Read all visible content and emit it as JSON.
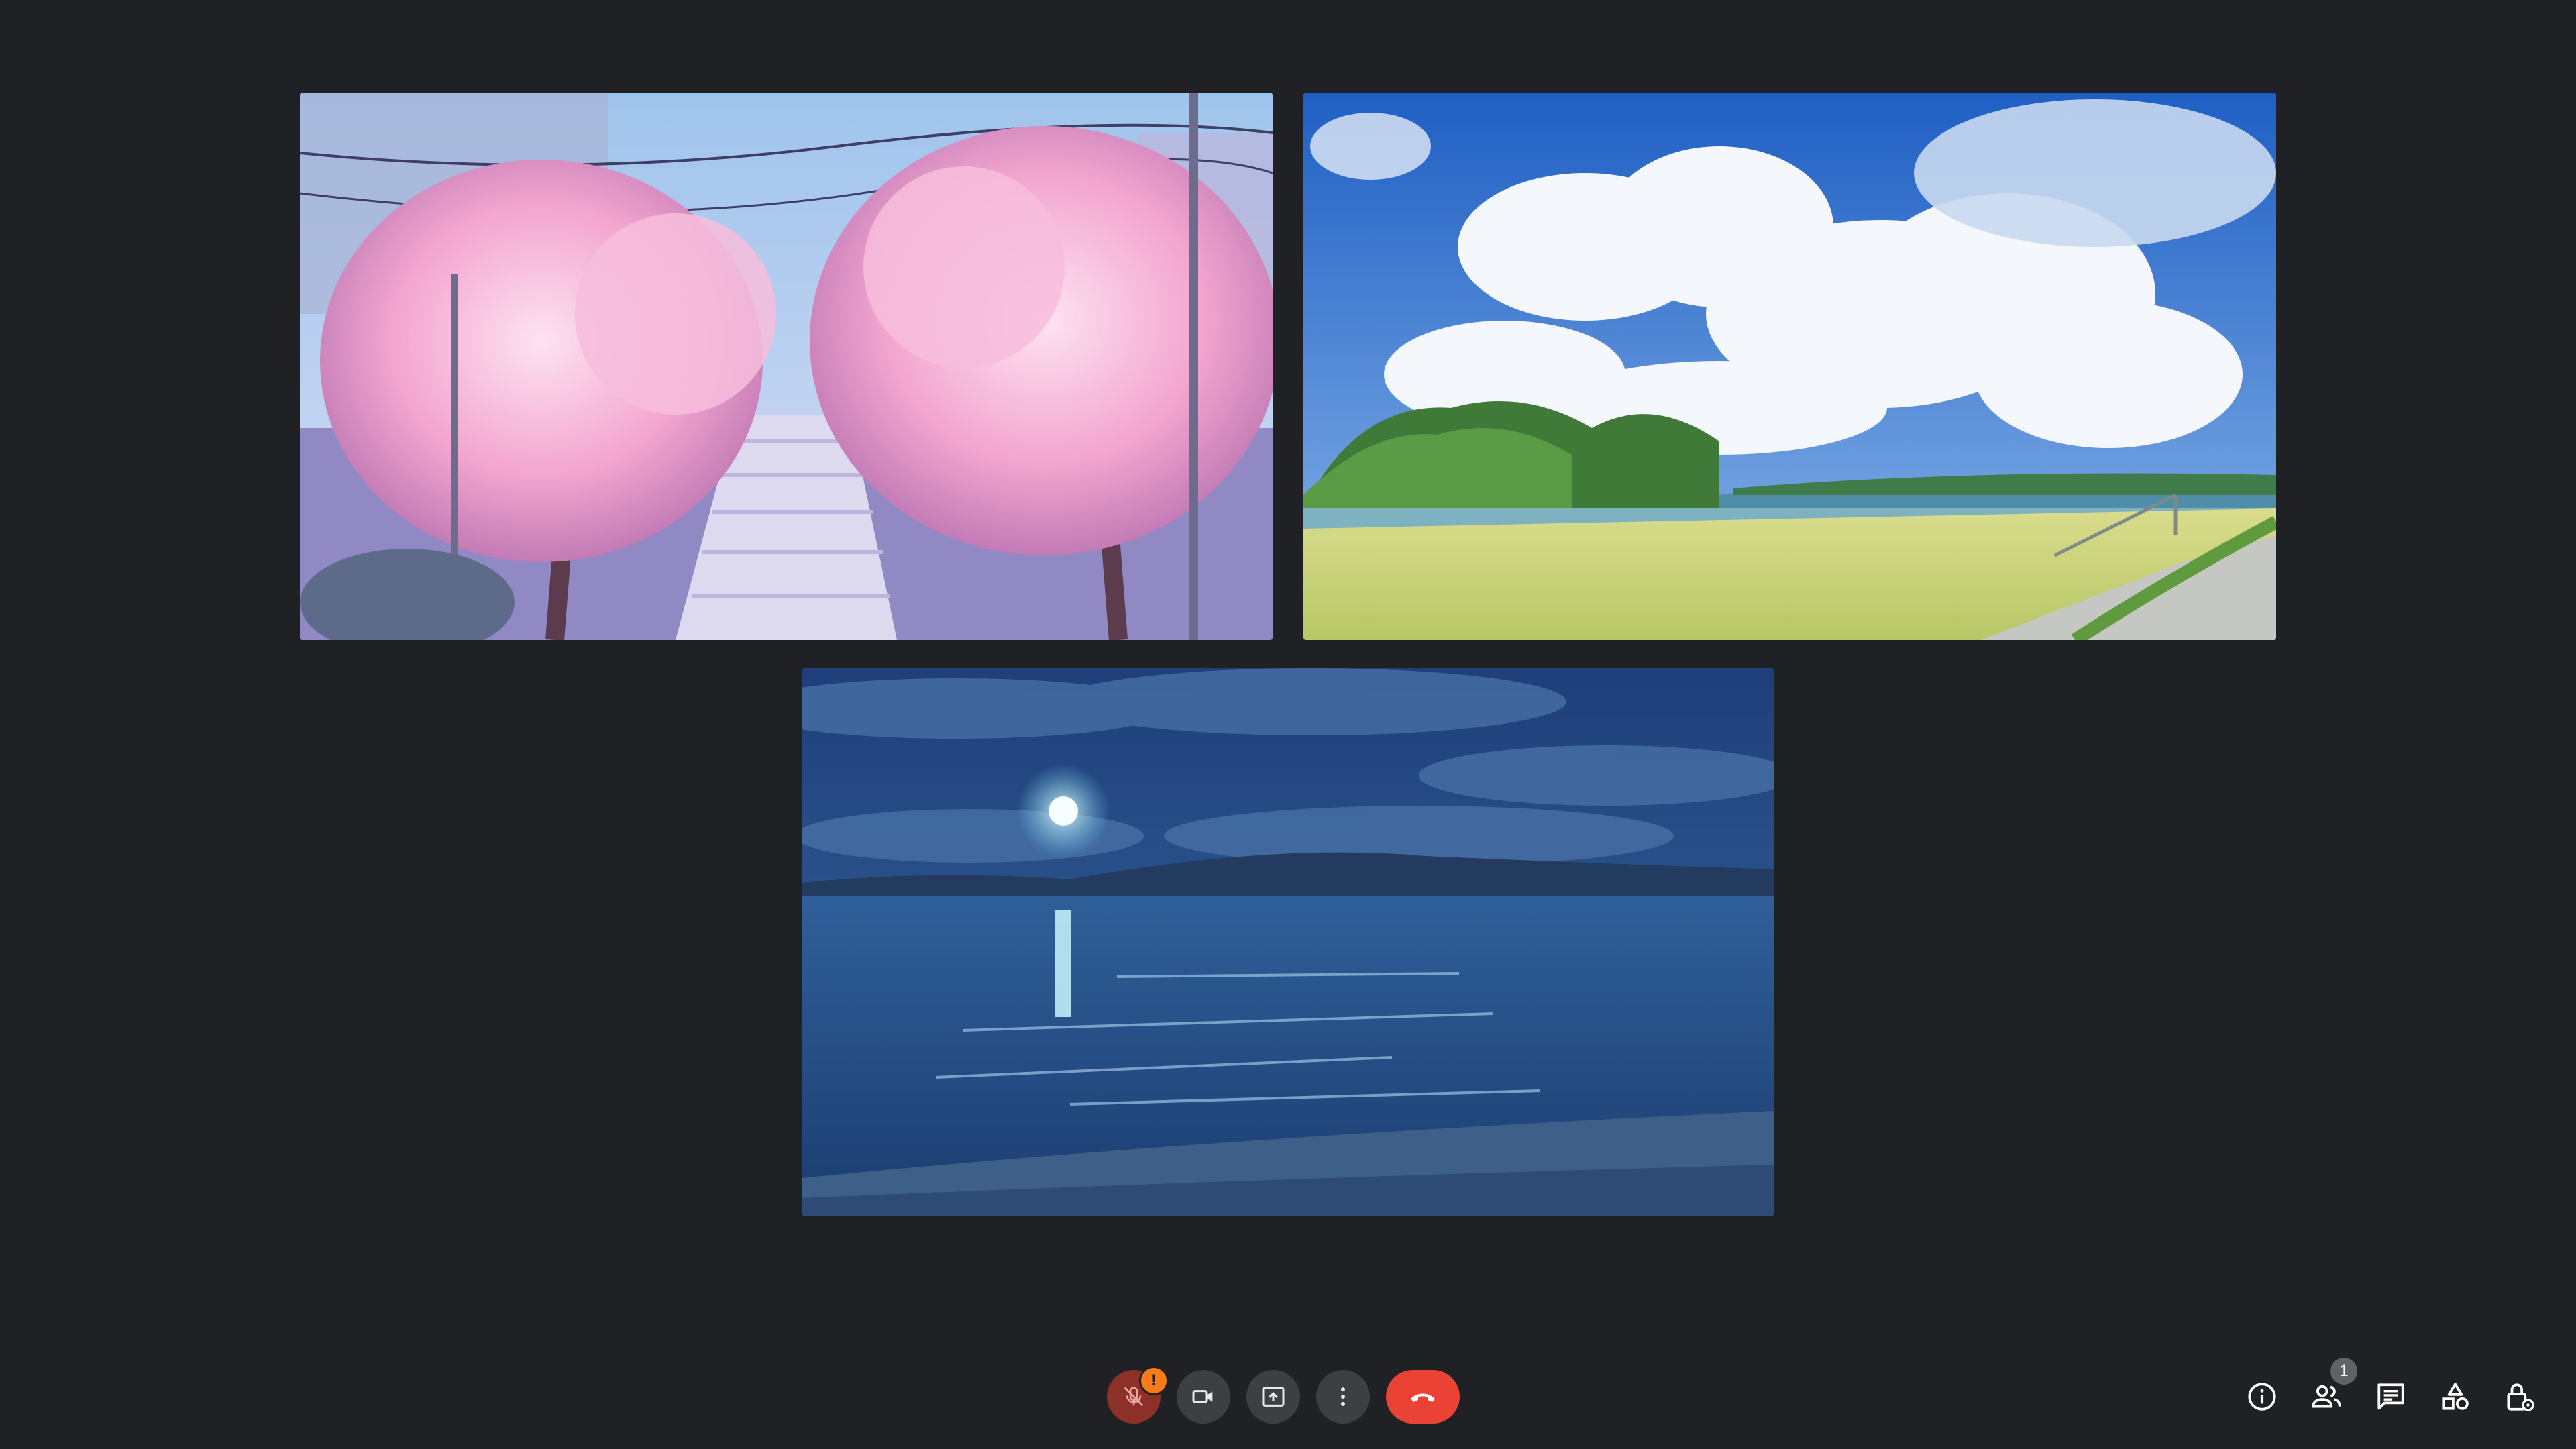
{
  "participants": [
    {
      "scene": "cherry-blossom-stairway"
    },
    {
      "scene": "summer-clouds-field"
    },
    {
      "scene": "moonlit-sea"
    }
  ],
  "controls": {
    "mic": {
      "icon": "mic-off-icon",
      "alert": "!"
    },
    "camera": {
      "icon": "videocam-icon"
    },
    "present": {
      "icon": "present-screen-icon"
    },
    "more": {
      "icon": "more-vert-icon"
    },
    "end_call": {
      "icon": "call-end-icon",
      "color": "#ea4335"
    }
  },
  "side_panel": {
    "people_count": "1"
  },
  "colors": {
    "background": "#202124",
    "button": "#3c4043",
    "alert": "#fa7b17"
  }
}
